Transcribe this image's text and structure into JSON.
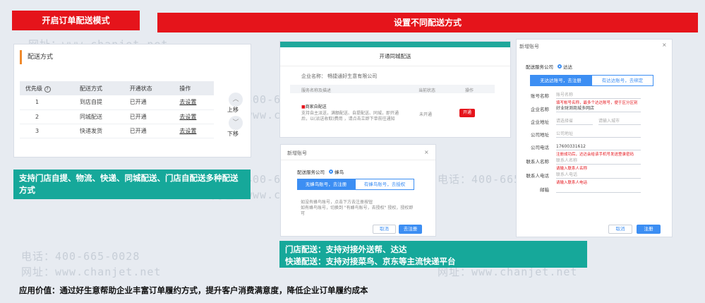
{
  "banner_left": "开启订单配送模式",
  "banner_right": "设置不同配送方式",
  "watermark": {
    "phone": "电话：400-665-0028",
    "site": "网址：www.chanjet.net"
  },
  "panel1": {
    "title": "配送方式",
    "columns": [
      "优先级",
      "配送方式",
      "开通状态",
      "操作"
    ],
    "rows": [
      {
        "p": "1",
        "m": "到店自提",
        "s": "已开通",
        "op": "去设置"
      },
      {
        "p": "2",
        "m": "同城配送",
        "s": "已开通",
        "op": "去设置"
      },
      {
        "p": "3",
        "m": "快递发货",
        "s": "已开通",
        "op": "去设置"
      }
    ],
    "up": "上移",
    "down": "下移"
  },
  "caption1": "支持门店自提、物流、快递、同城配送、门店自配送多种配送方式",
  "panel2": {
    "title": "开通同城配送",
    "company": "企业名称： 畅捷通好生意有限公司",
    "col_name": "服务名称及描述",
    "col_status": "当前状态",
    "col_op": "操作",
    "service": "商家自配送",
    "desc": "支持自主派送，满额配送、自提配送、同城，即开通后，以(派送收取)费用 ，请点击立即下单前往通知",
    "status": "未开通",
    "btn": "开通"
  },
  "panel3": {
    "title": "新增账号",
    "provider_label": "配送服务公司",
    "provider": "蜂鸟",
    "tab_on": "无蜂鸟账号，去注册",
    "tab_off": "有蜂鸟账号，去授权",
    "hint1": "如没有蜂鸟账号，点击下方去注册按钮",
    "hint2": "如有蜂鸟账号，切换到 \"有蜂鸟账号，去授权\" 授权，授权即可",
    "cancel": "取消",
    "ok": "去注册"
  },
  "caption2_line1": "门店配送：支持对接外送帮、达达",
  "caption2_line2": "快递配送：支持对接菜鸟、京东等主流快递平台",
  "panel4": {
    "title": "新增账号",
    "provider_label": "配送服务公司",
    "provider": "达达",
    "tab_on": "无达达账号，去注册",
    "tab_off": "有达达账号，去绑定",
    "fields": [
      {
        "label": "账号名称",
        "value": "账号名称",
        "err": "填写帐号名称，最多个达达账号，便于区分区别"
      },
      {
        "label": "企业名称",
        "value": "好业财测商城多网店",
        "err": ""
      },
      {
        "label": "企业地址",
        "value": "请选择省",
        "err": ""
      },
      {
        "label": "公司地址",
        "value": "公司地址",
        "err": ""
      },
      {
        "label": "公司电话",
        "value": "17600331612",
        "err": "注册成功后，达达会给该手机号发送登录密码"
      },
      {
        "label": "联系人名称",
        "value": "联系人名称",
        "err": "请输入联系人名称"
      },
      {
        "label": "联系人电话",
        "value": "联系人电话",
        "err": "请输入联系人电话"
      },
      {
        "label": "邮箱",
        "value": "",
        "err": ""
      }
    ],
    "city_placeholder": "请输入城市",
    "cancel": "取消",
    "ok": "注册"
  },
  "footer": "应用价值：通过好生意帮助企业丰富订单履约方式，提升客户消费满意度，降低企业订单履约成本"
}
